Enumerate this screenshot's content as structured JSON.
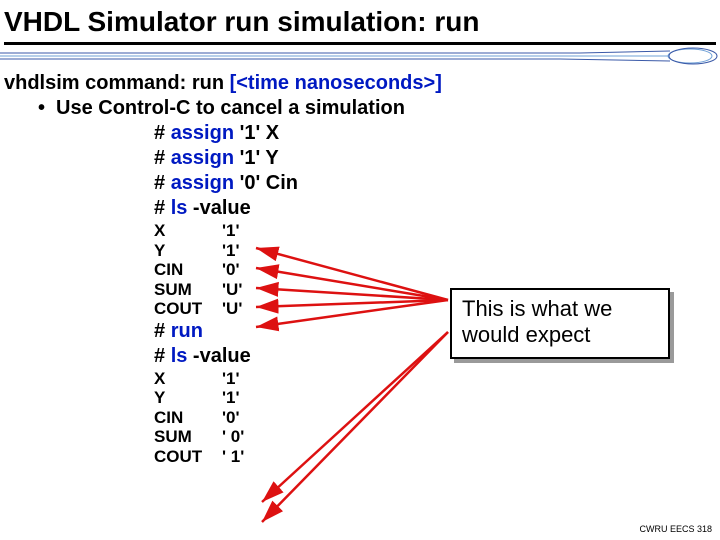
{
  "title": "VHDL Simulator run simulation: run",
  "cmd_prefix": "vhdlsim command: ",
  "cmd_name": "run",
  "cmd_args": " [<time nanoseconds>]",
  "bullet": "Use Control-C to cancel a simulation",
  "hash1": {
    "h": "# ",
    "a": "assign",
    "rest": " '1' X"
  },
  "hash2": {
    "h": "# ",
    "a": "assign",
    "rest": " '1' Y"
  },
  "hash3": {
    "h": "# ",
    "a": "assign",
    "rest": " '0' Cin"
  },
  "hash4": {
    "h": "# ",
    "a": "ls",
    "rest": " -value"
  },
  "sig1": [
    {
      "n": "X",
      "v": "'1'"
    },
    {
      "n": "Y",
      "v": "'1'"
    },
    {
      "n": "CIN",
      "v": "'0'"
    },
    {
      "n": "SUM",
      "v": "'U'"
    },
    {
      "n": "COUT",
      "v": "'U'"
    }
  ],
  "hash5": {
    "h": "# ",
    "a": "run",
    "rest": ""
  },
  "hash6": {
    "h": "# ",
    "a": "ls",
    "rest": " -value"
  },
  "sig2": [
    {
      "n": "X",
      "v": "'1'"
    },
    {
      "n": "Y",
      "v": "'1'"
    },
    {
      "n": "CIN",
      "v": "'0'"
    },
    {
      "n": "SUM",
      "v": "' 0'"
    },
    {
      "n": "COUT",
      "v": "' 1'"
    }
  ],
  "callout": "This is what we would expect",
  "footer": "CWRU EECS 318"
}
